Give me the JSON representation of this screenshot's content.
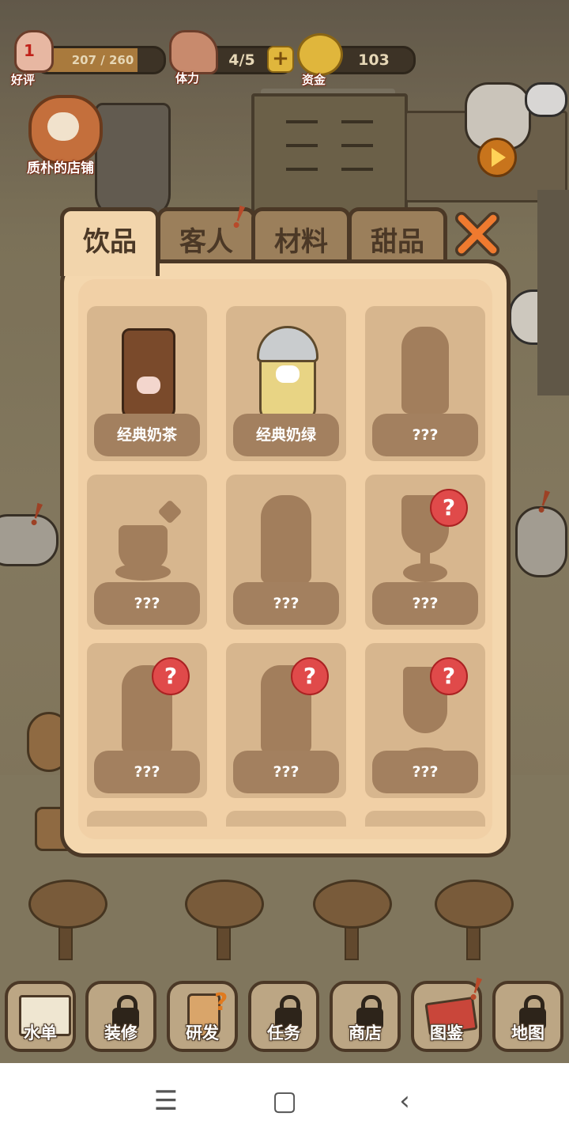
{
  "hud": {
    "reputation": {
      "label": "好评",
      "value": "207 / 260",
      "level": "1",
      "progress": 0.796
    },
    "stamina": {
      "label": "体力",
      "value": "4/5",
      "plus_icon": "plus-icon"
    },
    "funds": {
      "label": "资金",
      "value": "103"
    }
  },
  "shop_name": "质朴的店铺",
  "modal": {
    "tabs": [
      {
        "label": "饮品",
        "active": true
      },
      {
        "label": "客人",
        "active": false,
        "alert": "!"
      },
      {
        "label": "材料",
        "active": false
      },
      {
        "label": "甜品",
        "active": false
      }
    ],
    "items": [
      {
        "name": "经典奶茶",
        "unlocked": true,
        "icon": "iced-milk-tea-icon",
        "new": false
      },
      {
        "name": "经典奶绿",
        "unlocked": true,
        "icon": "milk-green-tea-icon",
        "new": false
      },
      {
        "name": "???",
        "unlocked": false,
        "icon": "tall-cup-silhouette-icon",
        "new": false
      },
      {
        "name": "???",
        "unlocked": false,
        "icon": "teacup-silhouette-icon",
        "new": false
      },
      {
        "name": "???",
        "unlocked": false,
        "icon": "tall-cup-silhouette-icon",
        "new": false
      },
      {
        "name": "???",
        "unlocked": false,
        "icon": "goblet-silhouette-icon",
        "new": true
      },
      {
        "name": "???",
        "unlocked": false,
        "icon": "tall-cup-silhouette-icon",
        "new": true
      },
      {
        "name": "???",
        "unlocked": false,
        "icon": "tall-cup-silhouette-icon",
        "new": true
      },
      {
        "name": "???",
        "unlocked": false,
        "icon": "sundae-glass-silhouette-icon",
        "new": true
      }
    ],
    "new_badge": "?"
  },
  "toolbar": [
    {
      "label": "水单",
      "locked": false,
      "icon": "menu-book-icon"
    },
    {
      "label": "装修",
      "locked": true,
      "icon": "hammer-icon"
    },
    {
      "label": "研发",
      "locked": false,
      "icon": "research-cup-icon"
    },
    {
      "label": "任务",
      "locked": true,
      "icon": "task-icon"
    },
    {
      "label": "商店",
      "locked": true,
      "icon": "shop-icon"
    },
    {
      "label": "图鉴",
      "locked": false,
      "icon": "catalog-box-icon",
      "alert": "!"
    },
    {
      "label": "地图",
      "locked": true,
      "icon": "map-icon"
    }
  ],
  "alert_mark": "!",
  "colors": {
    "panel": "#f2d5ac",
    "card": "#d7b68e",
    "card_label": "#a3805f",
    "badge": "#e04a4a",
    "border": "#4b3826"
  },
  "system_nav": {
    "menu": "☰",
    "home": "▢",
    "back": "‹"
  }
}
